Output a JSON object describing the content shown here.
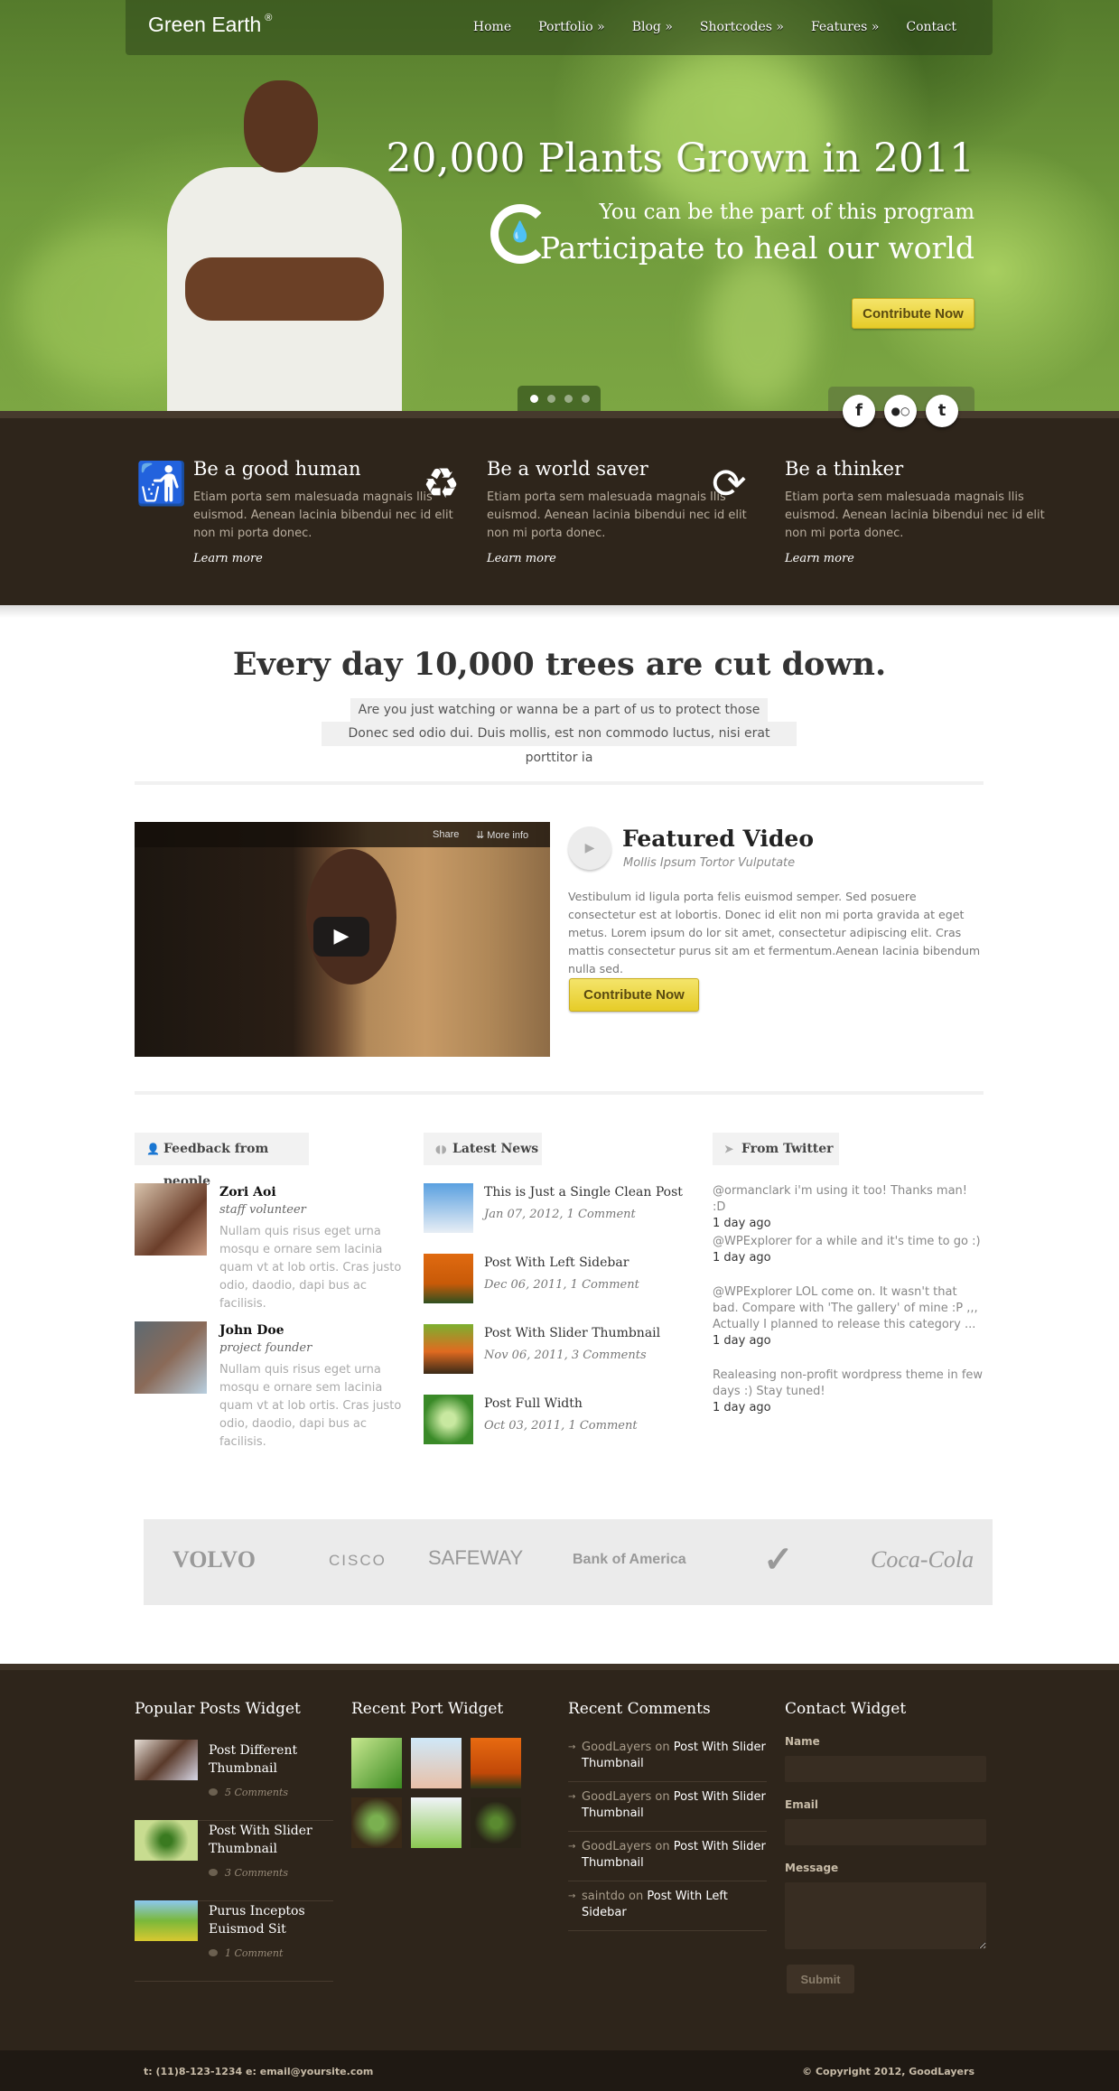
{
  "header": {
    "logo": "Green Earth",
    "logo_mark": "®",
    "nav": [
      "Home",
      "Portfolio »",
      "Blog »",
      "Shortcodes »",
      "Features »",
      "Contact"
    ]
  },
  "hero": {
    "headline": "20,000 Plants Grown in 2011",
    "subline": "You can be the part of this program",
    "tagline": "Participate to heal our world",
    "cta": "Contribute Now",
    "slide_count": 4,
    "active_slide": 1,
    "social": [
      {
        "name": "facebook",
        "glyph": "f"
      },
      {
        "name": "flickr",
        "glyph": "●○"
      },
      {
        "name": "twitter",
        "glyph": "t"
      }
    ]
  },
  "features": [
    {
      "icon": "person-trash-icon",
      "title": "Be a good human",
      "text": "Etiam porta sem malesuada magnais llis euismod. Aenean lacinia bibendui nec id elit non mi porta donec.",
      "link": "Learn more"
    },
    {
      "icon": "recycle-bin-icon",
      "title": "Be a world saver",
      "text": "Etiam porta sem malesuada magnais llis euismod. Aenean lacinia bibendui nec id elit non mi porta donec.",
      "link": "Learn more"
    },
    {
      "icon": "refresh-icon",
      "title": "Be a thinker",
      "text": "Etiam porta sem malesuada magnais llis euismod. Aenean lacinia bibendui nec id elit non mi porta donec.",
      "link": "Learn more"
    }
  ],
  "intro": {
    "heading": "Every day 10,000 trees are cut down.",
    "line1": "Are you just watching or wanna be a part of us to protect those trees",
    "line2": "Donec sed odio dui. Duis mollis, est non commodo luctus, nisi erat porttitor ia"
  },
  "video": {
    "share": "Share",
    "more_info": "More info",
    "title": "Featured Video",
    "subtitle": "Mollis Ipsum Tortor Vulputate",
    "text": "Vestibulum id ligula porta felis euismod semper. Sed posuere consectetur est at lobortis. Donec id elit non mi porta gravida at eget metus. Lorem ipsum do lor sit amet, consectetur adipiscing elit. Cras mattis consectetur purus sit am et fermentum.Aenean lacinia bibendum nulla sed.",
    "cta": "Contribute Now"
  },
  "feedback": {
    "title": "Feedback from people",
    "items": [
      {
        "name": "Zori Aoi",
        "role": "staff volunteer",
        "text": "Nullam quis risus eget urna mosqu e ornare sem lacinia quam vt at lob ortis. Cras justo odio, daodio, dapi bus ac facilisis."
      },
      {
        "name": "John Doe",
        "role": "project founder",
        "text": "Nullam quis risus eget urna mosqu e ornare sem lacinia quam vt at lob ortis. Cras justo odio, daodio, dapi bus ac facilisis."
      }
    ]
  },
  "news": {
    "title": "Latest News",
    "items": [
      {
        "title": "This is Just a Single Clean Post",
        "meta": "Jan 07, 2012, 1 Comment"
      },
      {
        "title": "Post With Left Sidebar",
        "meta": "Dec 06, 2011, 1 Comment"
      },
      {
        "title": "Post With Slider Thumbnail",
        "meta": "Nov 06, 2011, 3 Comments"
      },
      {
        "title": "Post Full Width",
        "meta": "Oct 03, 2011, 1 Comment"
      }
    ]
  },
  "twitter": {
    "title": "From Twitter",
    "items": [
      {
        "text": "@ormanclark i'm using it too! Thanks man! :D",
        "time": "1 day ago"
      },
      {
        "text": "@WPExplorer for a while and it's time to go :)",
        "time": "1 day ago"
      },
      {
        "text": "@WPExplorer LOL come on. It wasn't that bad. Compare with 'The gallery' of mine :P ,,, Actually I planned to release this category ...",
        "time": "1 day ago"
      },
      {
        "text": "Realeasing non-profit wordpress theme in few days :) Stay tuned!",
        "time": "1 day ago"
      }
    ]
  },
  "partners": [
    "VOLVO",
    "CISCO",
    "SAFEWAY",
    "Bank of America",
    "Nike",
    "Coca-Cola"
  ],
  "footer": {
    "popular": {
      "title": "Popular Posts Widget",
      "items": [
        {
          "title": "Post Different Thumbnail",
          "comments": "5 Comments"
        },
        {
          "title": "Post With Slider Thumbnail",
          "comments": "3 Comments"
        },
        {
          "title": "Purus Inceptos Euismod Sit",
          "comments": "1 Comment"
        }
      ]
    },
    "portfolio": {
      "title": "Recent Port Widget"
    },
    "comments": {
      "title": "Recent Comments",
      "items": [
        {
          "author": "GoodLayers",
          "on": "on",
          "post": "Post With Slider Thumbnail"
        },
        {
          "author": "GoodLayers",
          "on": "on",
          "post": "Post With Slider Thumbnail"
        },
        {
          "author": "GoodLayers",
          "on": "on",
          "post": "Post With Slider Thumbnail"
        },
        {
          "author": "saintdo",
          "on": "on",
          "post": "Post With Left Sidebar"
        }
      ]
    },
    "contact": {
      "title": "Contact Widget",
      "name_label": "Name",
      "email_label": "Email",
      "message_label": "Message",
      "name_value": "",
      "email_value": "",
      "message_value": "",
      "submit": "Submit"
    },
    "contact_line": "t: (11)8-123-1234 e: email@yoursite.com",
    "copyright": "© Copyright 2012, GoodLayers"
  }
}
